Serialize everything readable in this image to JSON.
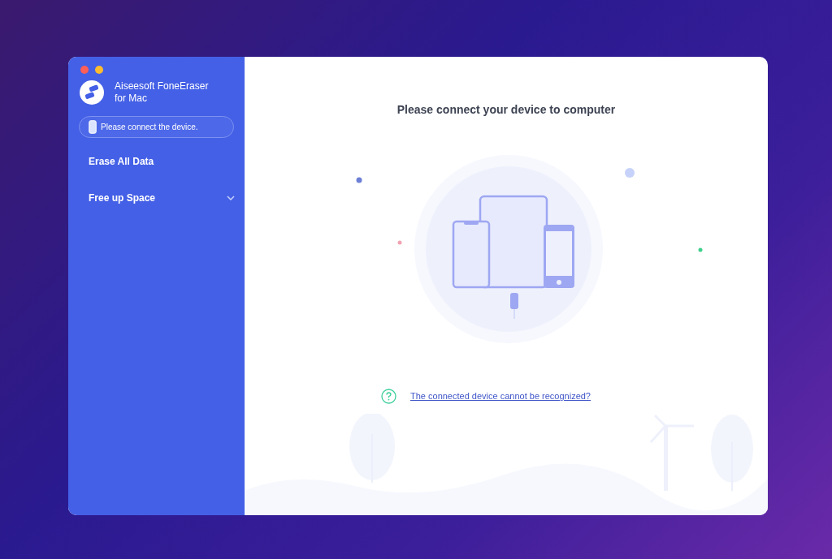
{
  "window": {
    "app_name": "Aiseesoft FoneEraser",
    "app_subtitle": "for Mac"
  },
  "device_status": "Please connect the device.",
  "sidebar": {
    "items": [
      {
        "label": "Erase All Data",
        "kind": "link"
      },
      {
        "label": "Free up Space",
        "kind": "group",
        "expanded": false
      }
    ]
  },
  "main": {
    "title": "Please connect your device to computer",
    "help_link": "The connected device cannot be recognized?"
  }
}
